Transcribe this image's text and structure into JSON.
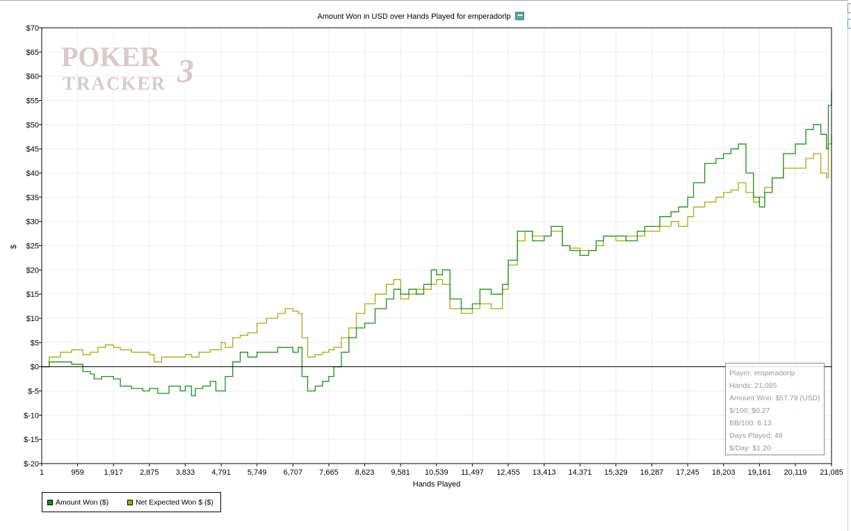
{
  "chart_data": {
    "type": "line",
    "title": "Amount Won in USD over Hands Played for emperadorlp",
    "xlabel": "Hands Played",
    "ylabel": "$",
    "xlim": [
      1,
      21085
    ],
    "ylim": [
      -20,
      70
    ],
    "x_ticks": [
      1,
      959,
      1917,
      2875,
      3833,
      4791,
      5749,
      6707,
      7665,
      8623,
      9581,
      10539,
      11497,
      12455,
      13413,
      14371,
      15329,
      16287,
      17245,
      18203,
      19161,
      20119,
      21085
    ],
    "x_tick_labels": [
      "1",
      "959",
      "1,917",
      "2,875",
      "3,833",
      "4,791",
      "5,749",
      "6,707",
      "7,665",
      "8,623",
      "9,581",
      "10,539",
      "11,497",
      "12,455",
      "13,413",
      "14,371",
      "15,329",
      "16,287",
      "17,245",
      "18,203",
      "19,161",
      "20,119",
      "21,085"
    ],
    "y_ticks": [
      70,
      65,
      60,
      55,
      50,
      45,
      40,
      35,
      30,
      25,
      20,
      15,
      10,
      5,
      0,
      -5,
      -10,
      -15,
      -20
    ],
    "y_tick_labels": [
      "$70",
      "$65",
      "$60",
      "$55",
      "$50",
      "$45",
      "$40",
      "$35",
      "$30",
      "$25",
      "$20",
      "$15",
      "$10",
      "$5",
      "$0",
      "$-5",
      "$-10",
      "$-15",
      "$-20"
    ],
    "grid": true,
    "legend_position": "bottom-left",
    "series": [
      {
        "name": "Amount Won ($)",
        "color": "#1a8c1a",
        "points": [
          [
            1,
            0
          ],
          [
            200,
            1
          ],
          [
            500,
            1
          ],
          [
            800,
            0.5
          ],
          [
            959,
            0.5
          ],
          [
            1100,
            -1
          ],
          [
            1300,
            -1.5
          ],
          [
            1400,
            -2.5
          ],
          [
            1600,
            -2
          ],
          [
            1917,
            -2.5
          ],
          [
            2100,
            -4
          ],
          [
            2400,
            -4.5
          ],
          [
            2700,
            -5
          ],
          [
            2875,
            -4.5
          ],
          [
            3100,
            -5.5
          ],
          [
            3400,
            -4
          ],
          [
            3700,
            -5
          ],
          [
            3833,
            -4
          ],
          [
            4000,
            -6
          ],
          [
            4100,
            -4.5
          ],
          [
            4300,
            -4
          ],
          [
            4500,
            -3
          ],
          [
            4650,
            -5
          ],
          [
            4791,
            -5
          ],
          [
            4900,
            -2
          ],
          [
            5100,
            1
          ],
          [
            5300,
            3
          ],
          [
            5500,
            2
          ],
          [
            5749,
            3
          ],
          [
            6000,
            3
          ],
          [
            6300,
            4
          ],
          [
            6500,
            4
          ],
          [
            6707,
            3
          ],
          [
            6850,
            4
          ],
          [
            6950,
            -2
          ],
          [
            7100,
            -5
          ],
          [
            7300,
            -4
          ],
          [
            7500,
            -3
          ],
          [
            7665,
            -2
          ],
          [
            7800,
            0
          ],
          [
            8000,
            3
          ],
          [
            8200,
            6
          ],
          [
            8400,
            8
          ],
          [
            8623,
            9
          ],
          [
            8900,
            12
          ],
          [
            9200,
            14
          ],
          [
            9400,
            16
          ],
          [
            9581,
            15
          ],
          [
            9800,
            16
          ],
          [
            10000,
            15
          ],
          [
            10200,
            17
          ],
          [
            10400,
            20
          ],
          [
            10539,
            19
          ],
          [
            10700,
            20
          ],
          [
            10900,
            14
          ],
          [
            11200,
            12
          ],
          [
            11497,
            13
          ],
          [
            11700,
            16
          ],
          [
            12000,
            15
          ],
          [
            12300,
            17
          ],
          [
            12455,
            22
          ],
          [
            12700,
            28
          ],
          [
            12900,
            28
          ],
          [
            13100,
            26
          ],
          [
            13413,
            27
          ],
          [
            13600,
            29
          ],
          [
            13900,
            25
          ],
          [
            14100,
            24
          ],
          [
            14371,
            23
          ],
          [
            14600,
            24
          ],
          [
            14800,
            26
          ],
          [
            15000,
            27
          ],
          [
            15329,
            27
          ],
          [
            15600,
            26
          ],
          [
            15900,
            28
          ],
          [
            16100,
            29
          ],
          [
            16287,
            29
          ],
          [
            16500,
            31
          ],
          [
            16800,
            32
          ],
          [
            17000,
            33
          ],
          [
            17245,
            35
          ],
          [
            17400,
            38
          ],
          [
            17700,
            42
          ],
          [
            18000,
            43
          ],
          [
            18203,
            44
          ],
          [
            18400,
            45
          ],
          [
            18600,
            46
          ],
          [
            18800,
            40
          ],
          [
            19000,
            35
          ],
          [
            19161,
            33
          ],
          [
            19300,
            36
          ],
          [
            19500,
            39
          ],
          [
            19800,
            44
          ],
          [
            20119,
            46
          ],
          [
            20400,
            49
          ],
          [
            20600,
            50
          ],
          [
            20800,
            48
          ],
          [
            20950,
            45
          ],
          [
            21000,
            54
          ],
          [
            21085,
            57
          ]
        ]
      },
      {
        "name": "Net Expected Won $ ($)",
        "color": "#a8a814",
        "points": [
          [
            1,
            0
          ],
          [
            200,
            2
          ],
          [
            500,
            3
          ],
          [
            800,
            3.5
          ],
          [
            959,
            3.5
          ],
          [
            1100,
            2.5
          ],
          [
            1300,
            3
          ],
          [
            1500,
            4
          ],
          [
            1700,
            4.5
          ],
          [
            1917,
            4
          ],
          [
            2100,
            3.5
          ],
          [
            2400,
            3
          ],
          [
            2600,
            3
          ],
          [
            2875,
            2.5
          ],
          [
            3000,
            1
          ],
          [
            3200,
            2
          ],
          [
            3500,
            2
          ],
          [
            3833,
            2.5
          ],
          [
            4000,
            2
          ],
          [
            4200,
            3
          ],
          [
            4500,
            3.5
          ],
          [
            4791,
            5
          ],
          [
            4900,
            4
          ],
          [
            5100,
            6
          ],
          [
            5300,
            6.5
          ],
          [
            5500,
            7
          ],
          [
            5749,
            9
          ],
          [
            6000,
            10
          ],
          [
            6300,
            11
          ],
          [
            6500,
            12
          ],
          [
            6707,
            11.5
          ],
          [
            6850,
            11
          ],
          [
            6950,
            6
          ],
          [
            7100,
            2
          ],
          [
            7300,
            2.5
          ],
          [
            7500,
            3
          ],
          [
            7665,
            3.5
          ],
          [
            7800,
            4
          ],
          [
            8000,
            6
          ],
          [
            8200,
            8
          ],
          [
            8400,
            11
          ],
          [
            8623,
            13
          ],
          [
            8900,
            15
          ],
          [
            9200,
            17
          ],
          [
            9400,
            18
          ],
          [
            9581,
            14
          ],
          [
            9800,
            15
          ],
          [
            10000,
            16
          ],
          [
            10200,
            16
          ],
          [
            10400,
            17
          ],
          [
            10539,
            18
          ],
          [
            10700,
            17
          ],
          [
            10900,
            12
          ],
          [
            11200,
            11
          ],
          [
            11497,
            12
          ],
          [
            11700,
            13
          ],
          [
            12000,
            12
          ],
          [
            12300,
            16
          ],
          [
            12455,
            21
          ],
          [
            12700,
            26
          ],
          [
            12900,
            28
          ],
          [
            13100,
            27
          ],
          [
            13413,
            27
          ],
          [
            13600,
            28
          ],
          [
            13900,
            25
          ],
          [
            14100,
            24.5
          ],
          [
            14371,
            24
          ],
          [
            14600,
            24
          ],
          [
            14800,
            25
          ],
          [
            15000,
            27
          ],
          [
            15329,
            26
          ],
          [
            15600,
            27
          ],
          [
            15900,
            27
          ],
          [
            16100,
            28
          ],
          [
            16287,
            28
          ],
          [
            16500,
            29
          ],
          [
            16800,
            30
          ],
          [
            17000,
            29
          ],
          [
            17245,
            31
          ],
          [
            17400,
            33
          ],
          [
            17700,
            34
          ],
          [
            18000,
            35
          ],
          [
            18203,
            36
          ],
          [
            18400,
            36.5
          ],
          [
            18600,
            38
          ],
          [
            18800,
            36
          ],
          [
            19000,
            34
          ],
          [
            19161,
            35
          ],
          [
            19300,
            37
          ],
          [
            19500,
            39
          ],
          [
            19800,
            41
          ],
          [
            20119,
            41
          ],
          [
            20400,
            43
          ],
          [
            20600,
            44
          ],
          [
            20800,
            40
          ],
          [
            20950,
            39
          ],
          [
            21000,
            46
          ],
          [
            21085,
            48
          ]
        ]
      }
    ]
  },
  "stats": [
    "Player: emperadorlp",
    "Hands: 21,085",
    "Amount Won: $57.79 (USD)",
    "$/100: $0.27",
    "BB/100: 6.13",
    "Days Played: 48",
    "$/Day: $1.20"
  ],
  "watermark": {
    "line1": "POKER",
    "line2": "TRACKER",
    "mark": "3"
  },
  "icons": {
    "title_icon": "chart-thumbnail-icon"
  }
}
